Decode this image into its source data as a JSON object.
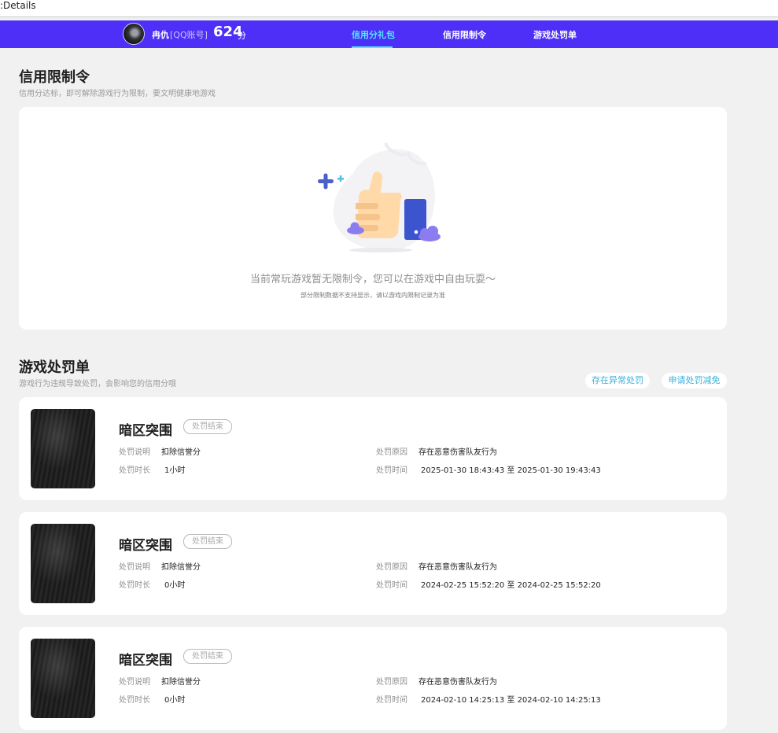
{
  "window": {
    "title": ":Details"
  },
  "header": {
    "user_name": "冉仇",
    "account_tag": "[QQ账号]",
    "score": "624",
    "score_unit": "分",
    "tabs": [
      {
        "label": "信用分礼包",
        "active": true
      },
      {
        "label": "信用限制令",
        "active": false
      },
      {
        "label": "游戏处罚单",
        "active": false
      }
    ]
  },
  "restriction": {
    "title": "信用限制令",
    "subtitle": "信用分达标，即可解除游戏行为限制，要文明健康地游戏",
    "empty_message": "当前常玩游戏暂无限制令，您可以在游戏中自由玩耍～",
    "empty_note": "部分限制数据不支持显示，请以游戏内限制记录为准"
  },
  "penalty": {
    "title": "游戏处罚单",
    "subtitle": "游戏行为违规导致处罚，会影响您的信用分哦",
    "report_button": "存在异常处罚",
    "appeal_button": "申请处罚减免",
    "labels": {
      "description": "处罚说明",
      "duration": "处罚时长",
      "reason": "处罚原因",
      "time": "处罚时间"
    },
    "records": [
      {
        "game": "暗区突围",
        "status": "处罚结束",
        "description": "扣除信誉分",
        "duration": "1小时",
        "reason": "存在恶意伤害队友行为",
        "time": "2025-01-30 18:43:43 至 2025-01-30 19:43:43"
      },
      {
        "game": "暗区突围",
        "status": "处罚结束",
        "description": "扣除信誉分",
        "duration": "0小时",
        "reason": "存在恶意伤害队友行为",
        "time": "2024-02-25 15:52:20 至 2024-02-25 15:52:20"
      },
      {
        "game": "暗区突围",
        "status": "处罚结束",
        "description": "扣除信誉分",
        "duration": "0小时",
        "reason": "存在恶意伤害队友行为",
        "time": "2024-02-10 14:25:13 至 2024-02-10 14:25:13"
      }
    ]
  },
  "colors": {
    "nav_background": "#4d2ff7",
    "active_tab": "#51e8ff",
    "page_background": "#f1f1f1",
    "link_button_text": "#3ab0d8"
  }
}
